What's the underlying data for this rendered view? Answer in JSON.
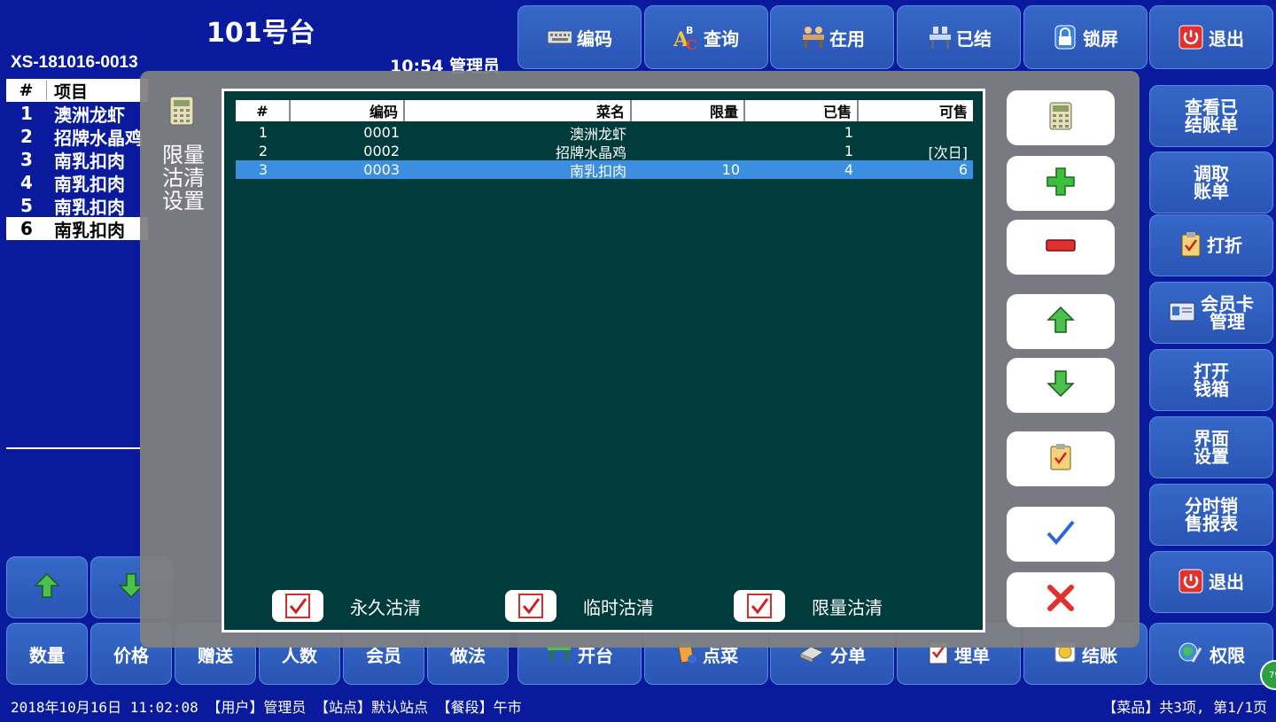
{
  "header": {
    "table_title": "101号台",
    "order_no": "XS-181016-0013",
    "time_user": "10:54 管理员"
  },
  "top_buttons": [
    {
      "label": "编码",
      "icon": "keyboard-icon"
    },
    {
      "label": "查询",
      "icon": "search-abc-icon"
    },
    {
      "label": "在用",
      "icon": "occupied-table-icon"
    },
    {
      "label": "已结",
      "icon": "settled-table-icon"
    },
    {
      "label": "锁屏",
      "icon": "lock-icon"
    },
    {
      "label": "退出",
      "icon": "power-icon"
    }
  ],
  "order_list": {
    "headers": [
      "#",
      "项目"
    ],
    "rows": [
      {
        "num": "1",
        "name": "澳洲龙虾"
      },
      {
        "num": "2",
        "name": "招牌水晶鸡"
      },
      {
        "num": "3",
        "name": "南乳扣肉"
      },
      {
        "num": "4",
        "name": "南乳扣肉"
      },
      {
        "num": "5",
        "name": "南乳扣肉"
      },
      {
        "num": "6",
        "name": "南乳扣肉"
      }
    ],
    "selected_index": 5
  },
  "side_buttons": [
    {
      "label": "查看已\n结账单",
      "icon": ""
    },
    {
      "label": "调取\n账单",
      "icon": ""
    },
    {
      "label": "打折",
      "icon": "clipboard-check-icon"
    },
    {
      "label": "会员卡\n管理",
      "icon": "member-card-icon"
    },
    {
      "label": "打开\n钱箱",
      "icon": ""
    },
    {
      "label": "界面\n设置",
      "icon": ""
    },
    {
      "label": "分时销\n售报表",
      "icon": ""
    },
    {
      "label": "退出",
      "icon": "power-icon"
    }
  ],
  "bottom_buttons": [
    {
      "label": "数量"
    },
    {
      "label": "价格"
    },
    {
      "label": "赠送"
    },
    {
      "label": "人数"
    },
    {
      "label": "会员"
    },
    {
      "label": "做法"
    },
    {
      "label": "开台",
      "icon": "table-icon"
    },
    {
      "label": "点菜",
      "icon": "order-icon"
    },
    {
      "label": "分单",
      "icon": "split-icon"
    },
    {
      "label": "埋单",
      "icon": "bill-icon"
    },
    {
      "label": "结账",
      "icon": "coin-icon"
    },
    {
      "label": "权限",
      "icon": "permission-icon"
    }
  ],
  "status": {
    "left": "2018年10月16日 11:02:08 【用户】管理员 【站点】默认站点 【餐段】午市",
    "right": "【菜品】共3项, 第1/1页",
    "badge": "79"
  },
  "modal": {
    "title": "限量沽清设置",
    "title_lines": [
      "限量",
      "沽清",
      "设置"
    ],
    "columns": [
      "#",
      "编码",
      "菜名",
      "限量",
      "已售",
      "可售"
    ],
    "rows": [
      {
        "num": "1",
        "code": "0001",
        "name": "澳洲龙虾",
        "limit": "",
        "sold": "1",
        "available": ""
      },
      {
        "num": "2",
        "code": "0002",
        "name": "招牌水晶鸡",
        "limit": "",
        "sold": "1",
        "available": "[次日]"
      },
      {
        "num": "3",
        "code": "0003",
        "name": "南乳扣肉",
        "limit": "10",
        "sold": "4",
        "available": "6"
      }
    ],
    "selected_row": 2,
    "checkboxes": [
      {
        "label": "永久沽清",
        "checked": true
      },
      {
        "label": "临时沽清",
        "checked": true
      },
      {
        "label": "限量沽清",
        "checked": true
      }
    ],
    "tools": [
      "calculator-icon",
      "plus-icon",
      "minus-icon",
      "arrow-up-icon",
      "arrow-down-icon",
      "clipboard-check-icon",
      "confirm-check-icon",
      "cancel-x-icon"
    ]
  },
  "colors": {
    "background": "#0a1a9c",
    "button": "#2a55b5",
    "grid_bg": "#003c3c",
    "selection": "#3b8ee0",
    "modal": "#808080"
  }
}
